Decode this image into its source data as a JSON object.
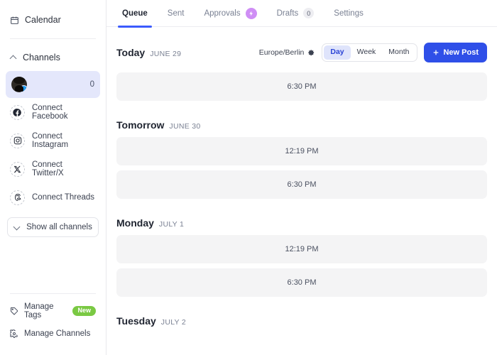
{
  "sidebar": {
    "calendar": {
      "label": "Calendar",
      "icon": "calendar-icon"
    },
    "channels_header": {
      "label": "Channels",
      "icon": "chevron-up-icon"
    },
    "channel": {
      "name": "",
      "count": "0",
      "avatar": "user-avatar",
      "badge": "twitter-badge"
    },
    "connect_items": [
      {
        "label": "Connect Facebook",
        "icon": "facebook-icon"
      },
      {
        "label": "Connect Instagram",
        "icon": "instagram-icon"
      },
      {
        "label": "Connect Twitter/X",
        "icon": "twitter-x-icon"
      },
      {
        "label": "Connect Threads",
        "icon": "threads-icon"
      }
    ],
    "show_all": {
      "label": "Show all channels",
      "icon": "chevron-down-icon"
    },
    "bottom_items": [
      {
        "label": "Manage Tags",
        "icon": "tag-icon",
        "badge": "New"
      },
      {
        "label": "Manage Channels",
        "icon": "gear-icon",
        "badge": ""
      }
    ]
  },
  "tabs": [
    {
      "label": "Queue",
      "active": true,
      "badge": "",
      "badge_type": "none"
    },
    {
      "label": "Sent",
      "active": false,
      "badge": "",
      "badge_type": "none"
    },
    {
      "label": "Approvals",
      "active": false,
      "badge": "⚡",
      "badge_type": "bolt"
    },
    {
      "label": "Drafts",
      "active": false,
      "badge": "0",
      "badge_type": "count"
    },
    {
      "label": "Settings",
      "active": false,
      "badge": "",
      "badge_type": "none"
    }
  ],
  "toolbar": {
    "timezone": "Europe/Berlin",
    "timezone_icon": "gear-icon",
    "views": [
      {
        "label": "Day",
        "selected": true
      },
      {
        "label": "Week",
        "selected": false
      },
      {
        "label": "Month",
        "selected": false
      }
    ],
    "new_post_label": "New Post",
    "new_post_icon": "plus-icon"
  },
  "groups": [
    {
      "day": "Today",
      "date": "JUNE 29",
      "slots": [
        {
          "time": "6:30 PM"
        }
      ]
    },
    {
      "day": "Tomorrow",
      "date": "JUNE 30",
      "slots": [
        {
          "time": "12:19 PM"
        },
        {
          "time": "6:30 PM"
        }
      ]
    },
    {
      "day": "Monday",
      "date": "JULY 1",
      "slots": [
        {
          "time": "12:19 PM"
        },
        {
          "time": "6:30 PM"
        }
      ]
    },
    {
      "day": "Tuesday",
      "date": "JULY 2",
      "slots": []
    }
  ],
  "colors": {
    "accent_blue": "#2f4fe8",
    "tab_underline": "#3b5bfd",
    "active_channel_bg": "#e4e7fb",
    "slot_bg": "#f4f4f5",
    "badge_green": "#7ac943",
    "badge_purple": "#cf8ef5"
  }
}
